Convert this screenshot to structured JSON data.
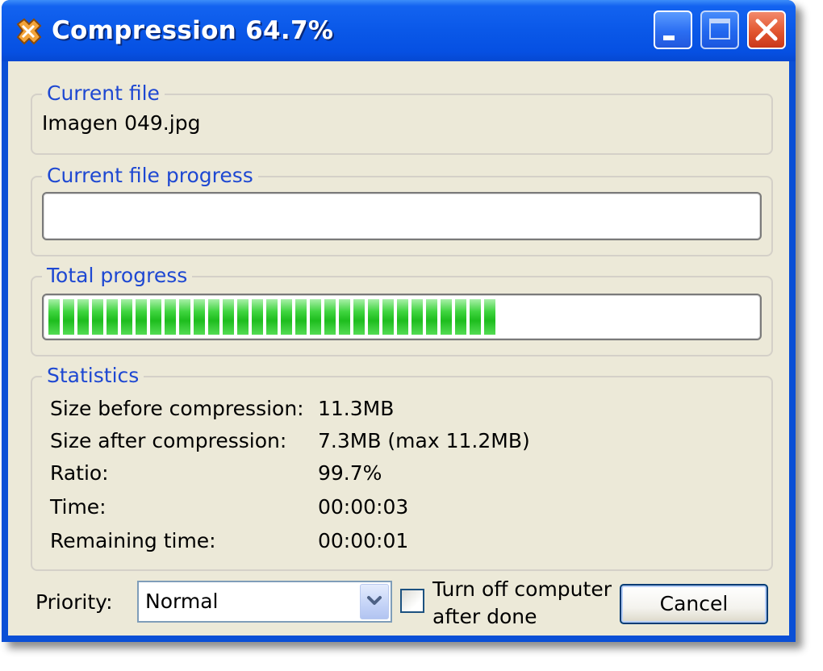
{
  "window": {
    "title": "Compression 64.7%"
  },
  "current_file": {
    "legend": "Current file",
    "value": "Imagen 049.jpg"
  },
  "current_file_progress": {
    "legend": "Current file progress",
    "percent": 0
  },
  "total_progress": {
    "legend": "Total progress",
    "percent": 64.7
  },
  "statistics": {
    "legend": "Statistics",
    "rows": [
      {
        "label": "Size before compression:",
        "value": "11.3MB"
      },
      {
        "label": "Size after compression:",
        "value": "7.3MB (max 11.2MB)"
      },
      {
        "label": "Ratio:",
        "value": "99.7%"
      },
      {
        "label": "Time:",
        "value": "00:00:03"
      },
      {
        "label": "Remaining time:",
        "value": "00:00:01"
      }
    ]
  },
  "footer": {
    "priority_label": "Priority:",
    "priority_value": "Normal",
    "shutdown_label_line1": "Turn off computer",
    "shutdown_label_line2": "after done",
    "shutdown_checked": false,
    "cancel_label": "Cancel"
  },
  "icons": {
    "app": "compression-app-icon",
    "minimize": "minimize-icon",
    "maximize": "maximize-icon",
    "close": "close-icon",
    "dropdown": "chevron-down-icon"
  },
  "colors": {
    "titlebar": "#0a58e8",
    "legend_text": "#1e48d2",
    "progress_green": "#1ebd1e",
    "close_button": "#e2562f"
  }
}
